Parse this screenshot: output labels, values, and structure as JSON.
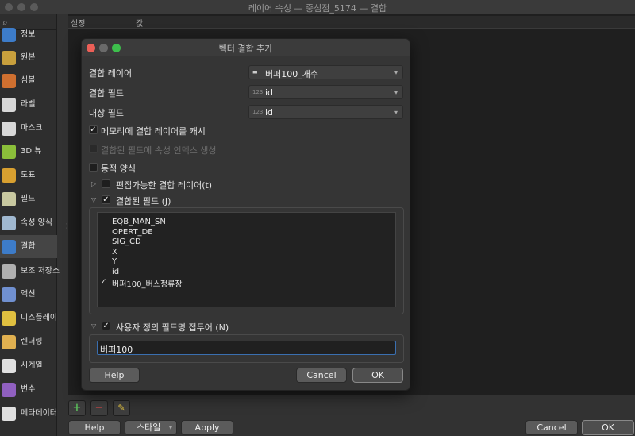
{
  "window": {
    "title": "레이어 속성 — 중심점_5174 — 결합"
  },
  "sidebar": {
    "items": [
      {
        "label": "정보",
        "icon": "info-icon",
        "color": "#3d7cc9"
      },
      {
        "label": "원본",
        "icon": "source-icon",
        "color": "#c9a03d"
      },
      {
        "label": "심볼",
        "icon": "symbology-icon",
        "color": "#d07030"
      },
      {
        "label": "라벨",
        "icon": "labels-icon",
        "color": "#d8d8d8"
      },
      {
        "label": "마스크",
        "icon": "mask-icon",
        "color": "#d8d8d8"
      },
      {
        "label": "3D 뷰",
        "icon": "3d-view-icon",
        "color": "#8bbf3a"
      },
      {
        "label": "도표",
        "icon": "diagram-icon",
        "color": "#d8a030"
      },
      {
        "label": "필드",
        "icon": "fields-icon",
        "color": "#c8c8a0"
      },
      {
        "label": "속성 양식",
        "icon": "attributes-form-icon",
        "color": "#a0b8d0"
      },
      {
        "label": "결합",
        "icon": "joins-icon",
        "color": "#3d7cc9"
      },
      {
        "label": "보조 저장소",
        "icon": "auxiliary-storage-icon",
        "color": "#b0b0b0"
      },
      {
        "label": "액션",
        "icon": "actions-icon",
        "color": "#7090d0"
      },
      {
        "label": "디스플레이",
        "icon": "display-icon",
        "color": "#e0c040"
      },
      {
        "label": "렌더링",
        "icon": "rendering-icon",
        "color": "#e0b050"
      },
      {
        "label": "시계열",
        "icon": "temporal-icon",
        "color": "#e0e0e0"
      },
      {
        "label": "변수",
        "icon": "variables-icon",
        "color": "#9060c0"
      },
      {
        "label": "메타데이터",
        "icon": "metadata-icon",
        "color": "#e0e0e0"
      }
    ]
  },
  "content": {
    "col_setting": "설정",
    "col_value": "값"
  },
  "bottom": {
    "help": "Help",
    "style": "스타일",
    "apply": "Apply",
    "cancel": "Cancel",
    "ok": "OK"
  },
  "dialog": {
    "title": "벡터 결합 추가",
    "join_layer_label": "결합 레이어",
    "join_layer_value": "버퍼100_개수",
    "join_field_label": "결합 필드",
    "join_field_value": "id",
    "target_field_label": "대상 필드",
    "target_field_value": "id",
    "cache_label": "메모리에 결합 레이어를 캐시",
    "index_label": "결합된 필드에 속성 인덱스 생성",
    "dynamic_form_label": "동적 양식",
    "editable_label": "편집가능한 결합 레이어(t)",
    "joined_fields_label": "결합된 필드 (J)",
    "fields": [
      {
        "name": "EQB_MAN_SN",
        "checked": false
      },
      {
        "name": "OPERT_DE",
        "checked": false
      },
      {
        "name": "SIG_CD",
        "checked": false
      },
      {
        "name": "X",
        "checked": false
      },
      {
        "name": "Y",
        "checked": false
      },
      {
        "name": "id",
        "checked": false
      },
      {
        "name": "버퍼100_버스정류장",
        "checked": true
      }
    ],
    "prefix_label": "사용자 정의 필드명 접두어 (N)",
    "prefix_value": "버퍼100",
    "help": "Help",
    "cancel": "Cancel",
    "ok": "OK",
    "check_mark": "✓"
  }
}
